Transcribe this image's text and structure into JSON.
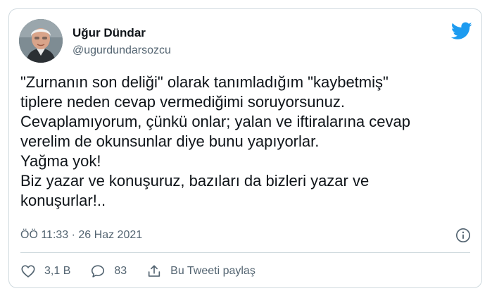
{
  "author": {
    "name": "Uğur Dündar",
    "handle": "@ugurdundarsozcu"
  },
  "tweet": {
    "lines": [
      "\"Zurnanın son deliği\" olarak tanımladığım \"kaybetmiş\"",
      "tiplere neden cevap vermediğimi soruyorsunuz.",
      "Cevaplamıyorum, çünkü onlar; yalan ve iftiralarına cevap",
      "verelim de okunsunlar diye bunu yapıyorlar.",
      "Yağma yok!",
      "Biz yazar ve konuşuruz, bazıları da bizleri yazar ve",
      "konuşurlar!.."
    ],
    "timestamp": "ÖÖ 11:33 · 26 Haz 2021"
  },
  "actions": {
    "likes": "3,1 B",
    "replies": "83",
    "share_label": "Bu Tweeti paylaş"
  },
  "colors": {
    "twitter_blue": "#1d9bf0",
    "secondary_text": "#536471",
    "border": "#cfd9de"
  },
  "icons": {
    "brand": "twitter-bird-icon",
    "info": "info-icon",
    "like": "heart-icon",
    "reply": "reply-icon",
    "share": "share-icon"
  }
}
